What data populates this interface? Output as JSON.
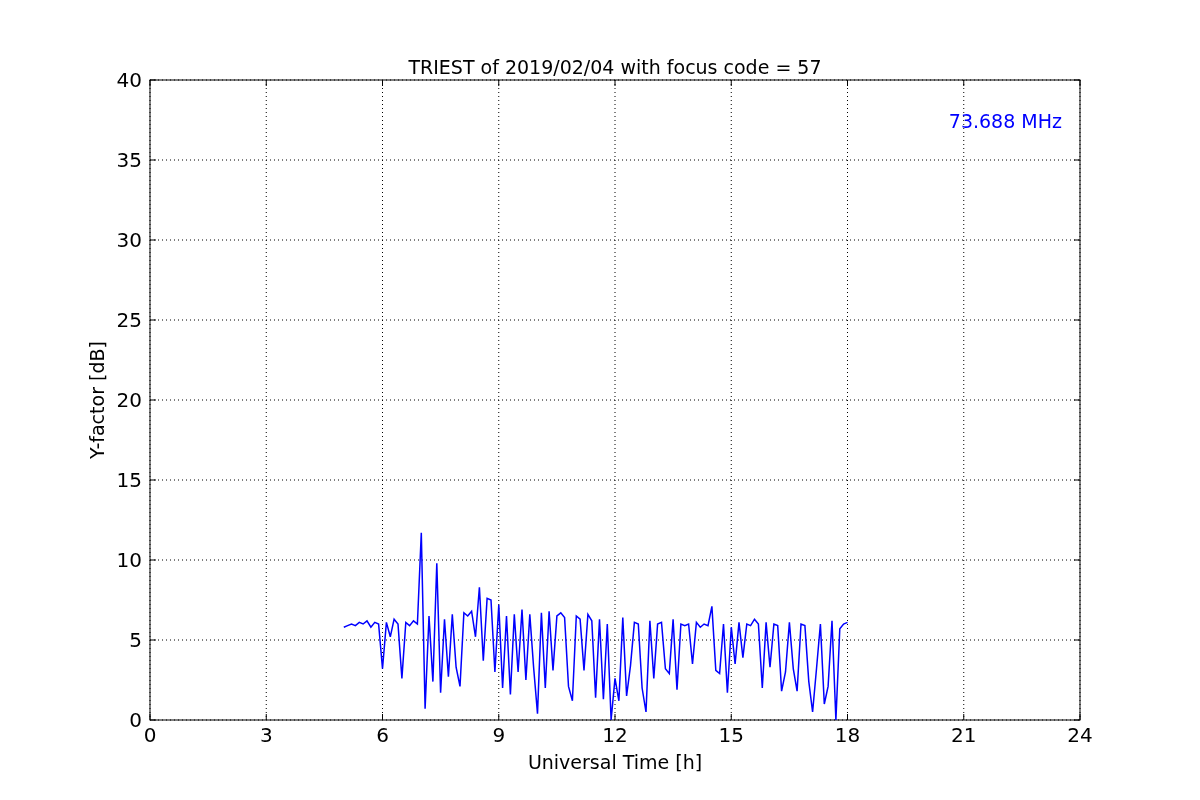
{
  "chart": {
    "chart_data": {
      "type": "line",
      "title": "TRIEST of 2019/02/04 with focus code = 57",
      "xlabel": "Universal Time [h]",
      "ylabel": "Y-factor [dB]",
      "x": [
        5.0,
        5.1,
        5.2,
        5.3,
        5.4,
        5.5,
        5.6,
        5.7,
        5.8,
        5.9,
        6.0,
        6.1,
        6.2,
        6.3,
        6.4,
        6.5,
        6.6,
        6.7,
        6.8,
        6.9,
        7.0,
        7.1,
        7.2,
        7.3,
        7.4,
        7.5,
        7.6,
        7.7,
        7.8,
        7.9,
        8.0,
        8.1,
        8.2,
        8.3,
        8.4,
        8.5,
        8.6,
        8.7,
        8.8,
        8.9,
        9.0,
        9.1,
        9.2,
        9.3,
        9.4,
        9.5,
        9.6,
        9.7,
        9.8,
        9.9,
        10.0,
        10.1,
        10.2,
        10.3,
        10.4,
        10.5,
        10.6,
        10.7,
        10.8,
        10.9,
        11.0,
        11.1,
        11.2,
        11.3,
        11.4,
        11.5,
        11.6,
        11.7,
        11.8,
        11.9,
        12.0,
        12.1,
        12.2,
        12.3,
        12.4,
        12.5,
        12.6,
        12.7,
        12.8,
        12.9,
        13.0,
        13.1,
        13.2,
        13.3,
        13.4,
        13.5,
        13.6,
        13.7,
        13.8,
        13.9,
        14.0,
        14.1,
        14.2,
        14.3,
        14.4,
        14.5,
        14.6,
        14.7,
        14.8,
        14.9,
        15.0,
        15.1,
        15.2,
        15.3,
        15.4,
        15.5,
        15.6,
        15.7,
        15.8,
        15.9,
        16.0,
        16.1,
        16.2,
        16.3,
        16.4,
        16.5,
        16.6,
        16.7,
        16.8,
        16.9,
        17.0,
        17.1,
        17.2,
        17.3,
        17.4,
        17.5,
        17.6,
        17.7,
        17.8,
        17.9,
        18.0
      ],
      "series": [
        {
          "name": "73.688 MHz",
          "color": "#0000ff",
          "values": [
            5.8,
            5.9,
            6.0,
            5.9,
            6.1,
            6.0,
            6.2,
            5.8,
            6.1,
            6.0,
            3.2,
            6.1,
            5.2,
            6.3,
            6.0,
            2.6,
            6.1,
            5.9,
            6.2,
            6.0,
            11.7,
            0.7,
            6.5,
            2.4,
            9.8,
            1.7,
            6.3,
            2.7,
            6.6,
            3.3,
            2.1,
            6.7,
            6.5,
            6.8,
            5.2,
            8.3,
            3.7,
            7.6,
            7.5,
            3.0,
            7.2,
            2.0,
            6.5,
            1.6,
            6.6,
            3.0,
            6.9,
            2.5,
            6.6,
            3.3,
            0.4,
            6.7,
            2.0,
            6.8,
            3.1,
            6.5,
            6.7,
            6.4,
            2.1,
            1.2,
            6.5,
            6.3,
            3.1,
            6.6,
            6.2,
            1.4,
            6.3,
            1.3,
            6.0,
            0.0,
            2.6,
            1.2,
            6.4,
            1.5,
            3.4,
            6.1,
            6.0,
            2.0,
            0.5,
            6.2,
            2.6,
            6.0,
            6.1,
            3.2,
            2.9,
            6.3,
            1.9,
            6.0,
            5.9,
            6.0,
            3.5,
            6.1,
            5.8,
            6.0,
            5.9,
            7.1,
            3.1,
            2.9,
            6.0,
            1.7,
            5.8,
            3.5,
            6.1,
            3.9,
            6.0,
            5.9,
            6.3,
            6.0,
            2.0,
            6.1,
            3.3,
            6.0,
            5.9,
            1.8,
            3.0,
            6.1,
            3.2,
            1.8,
            6.0,
            5.9,
            2.4,
            0.5,
            3.2,
            6.0,
            1.0,
            2.1,
            6.2,
            0.0,
            5.7,
            6.0,
            6.1
          ]
        }
      ],
      "xlim": [
        0,
        24
      ],
      "ylim": [
        0,
        40
      ],
      "xticks": [
        0,
        3,
        6,
        9,
        12,
        15,
        18,
        21,
        24
      ],
      "yticks": [
        0,
        5,
        10,
        15,
        20,
        25,
        30,
        35,
        40
      ],
      "grid": true
    }
  }
}
